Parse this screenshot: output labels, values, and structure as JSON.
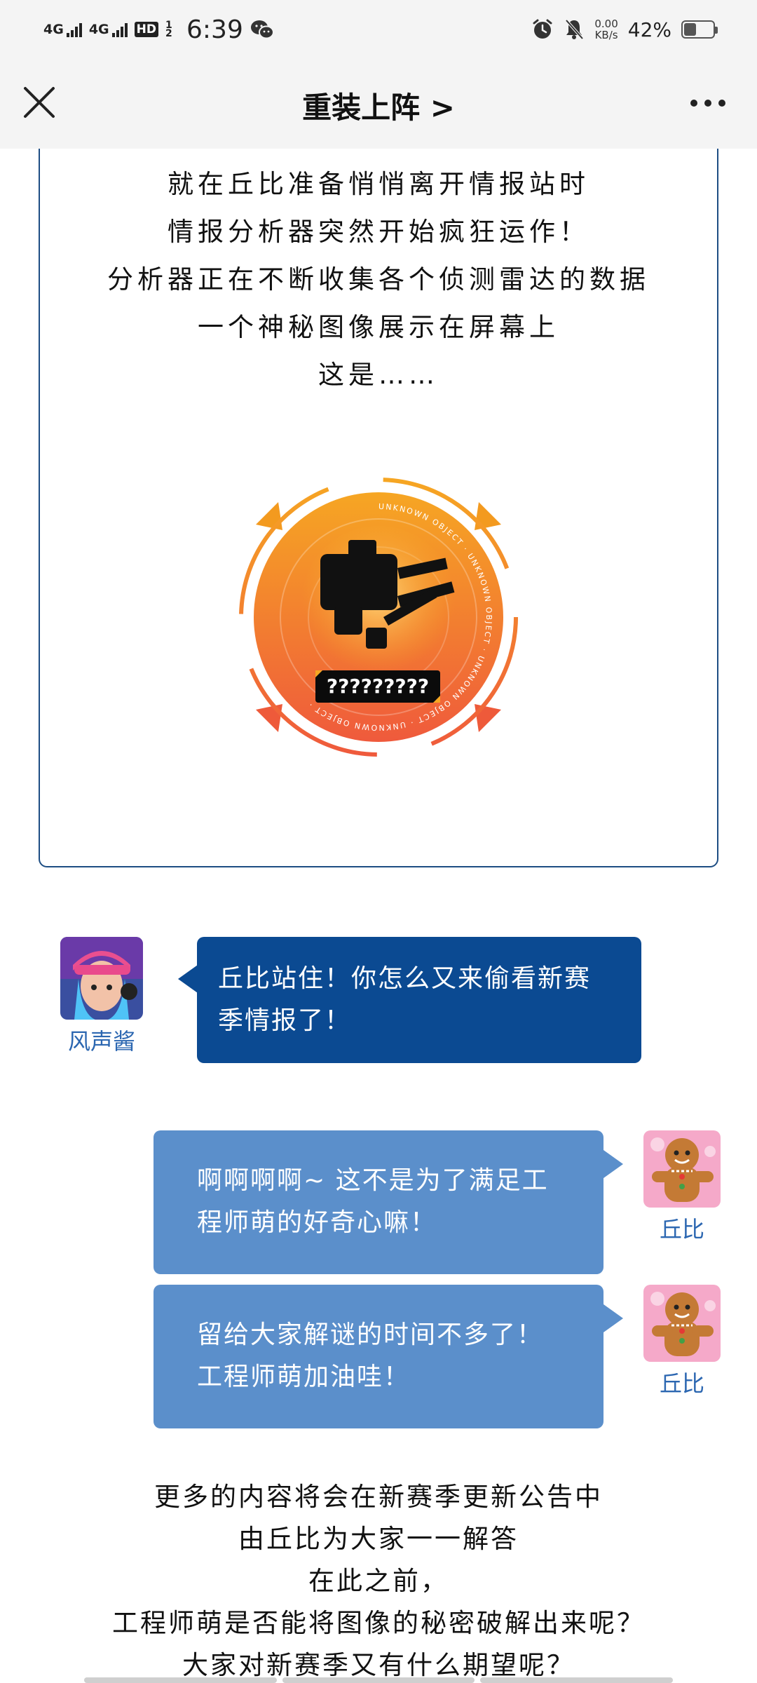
{
  "status_bar": {
    "network1": "4G",
    "network2": "4G",
    "hd_label": "HD",
    "hd_sub": "1 2",
    "time": "6:39",
    "speed_value": "0.00",
    "speed_unit": "KB/s",
    "battery_percent": "42%",
    "battery_level": 0.42
  },
  "nav": {
    "title": "重装上阵 >"
  },
  "story": {
    "intro_lines": [
      "就在丘比准备悄悄离开情报站时",
      "情报分析器突然开始疯狂运作！",
      "分析器正在不断收集各个侦测雷达的数据",
      "一个神秘图像展示在屏幕上",
      "这是……"
    ],
    "emblem": {
      "ring_text": "UNKNOWN OBJECT · UNKNOWN OBJECT · UNKNOWN OBJECT · UNKNOWN OBJECT ·",
      "label": "?????????"
    }
  },
  "chat": [
    {
      "speaker": "风声酱",
      "side": "left",
      "lines": [
        "丘比站住！你怎么又来偷看新赛",
        "季情报了！"
      ]
    },
    {
      "speaker": "丘比",
      "side": "right",
      "lines": [
        "啊啊啊啊~ 这不是为了满足工",
        "程师萌的好奇心嘛！"
      ]
    },
    {
      "speaker": "丘比",
      "side": "right",
      "lines": [
        "留给大家解谜的时间不多了！",
        "工程师萌加油哇！"
      ]
    }
  ],
  "outro_lines": [
    "更多的内容将会在新赛季更新公告中",
    "由丘比为大家一一解答",
    "在此之前，",
    "工程师萌是否能将图像的秘密破解出来呢？",
    "大家对新赛季又有什么期望呢？"
  ],
  "colors": {
    "accent_dark": "#0b4a92",
    "accent_light": "#5b8fcb",
    "name_blue": "#2c67b1",
    "emblem_orange": "#f39a1f",
    "emblem_red": "#ee5a3a"
  }
}
